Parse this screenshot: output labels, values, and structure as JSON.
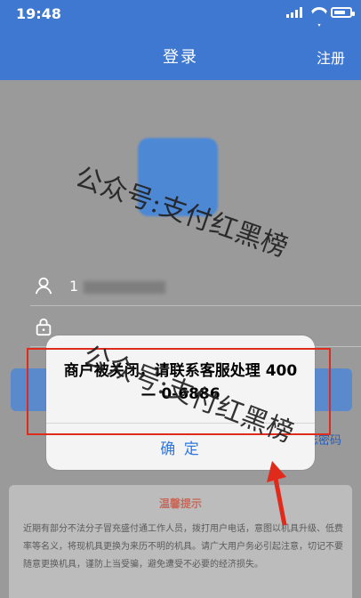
{
  "status": {
    "time": "19:48",
    "signal_icon": "signal-icon",
    "wifi_icon": "wifi-icon",
    "battery_icon": "battery-icon"
  },
  "nav": {
    "title": "登录",
    "register": "注册"
  },
  "login": {
    "username_value": "1",
    "user_icon": "user-icon",
    "lock_icon": "lock-icon"
  },
  "forgot_password": "忘密码",
  "tips": {
    "title": "温馨提示",
    "text": "近期有部分不法分子冒充盛付通工作人员，拨打用户电话，意图以机具升级、低费率等名义，将现机具更换为来历不明的机具。请广大用户务必引起注意，切记不要随意更换机具，谨防上当受骗，避免遭受不必要的经济损失。"
  },
  "modal": {
    "message": "商户被关闭，请联系客服处理 400 — 0-6886",
    "confirm": "确 定"
  },
  "watermark": {
    "text": "公众号:支付红黑榜"
  },
  "colors": {
    "brand_blue": "#3f78d0",
    "alert_red": "#e02a1c",
    "confirm_blue": "#2d78e3"
  }
}
